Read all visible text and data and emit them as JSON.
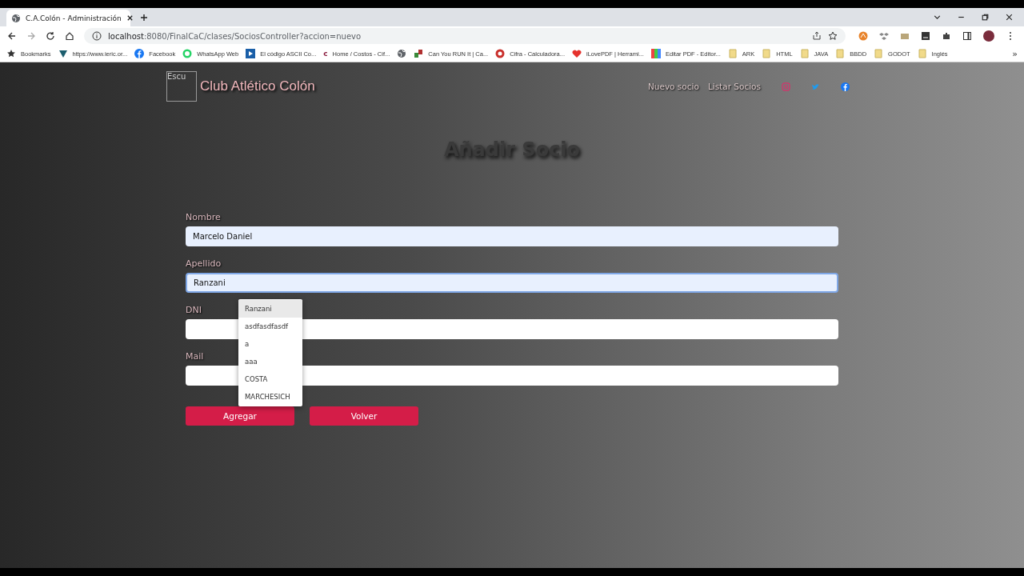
{
  "browser": {
    "tab_title": "C.A.Colón - Administración",
    "url_host": "localhost",
    "url_path": ":8080/FinalCaC/clases/SociosController?accion=nuevo",
    "bookmarks": [
      {
        "label": "Bookmarks",
        "kind": "star"
      },
      {
        "label": "https://www.ieric.or...",
        "kind": "triangle"
      },
      {
        "label": "Facebook",
        "kind": "facebook"
      },
      {
        "label": "WhatsApp Web",
        "kind": "whatsapp"
      },
      {
        "label": "El código ASCII Co...",
        "kind": "play"
      },
      {
        "label": "Home / Costos - Cif...",
        "kind": "letter"
      },
      {
        "kind": "globe"
      },
      {
        "label": "Can You RUN It | Ca...",
        "kind": "game"
      },
      {
        "label": "Cifra - Calculadora...",
        "kind": "cifra"
      },
      {
        "label": "iLovePDF | Herrami...",
        "kind": "heart"
      },
      {
        "label": "Editar PDF - Editor...",
        "kind": "grid"
      },
      {
        "label": "ARK",
        "kind": "folder"
      },
      {
        "label": "HTML",
        "kind": "folder"
      },
      {
        "label": "JAVA",
        "kind": "folder"
      },
      {
        "label": "BBDD",
        "kind": "folder"
      },
      {
        "label": "GODOT",
        "kind": "folder"
      },
      {
        "label": "Inglés",
        "kind": "folder"
      }
    ],
    "bookmark_letter": "c",
    "more": "»"
  },
  "site": {
    "logo_alt": "Escu",
    "title": "Club Atlético Colón",
    "nav": [
      "Nuevo socio",
      "Listar Socios"
    ]
  },
  "heading": "Añadir Socio",
  "fields": [
    {
      "label": "Nombre",
      "value": "Marcelo Daniel",
      "autofilled": true,
      "focused": false
    },
    {
      "label": "Apellido",
      "value": "Ranzani",
      "autofilled": true,
      "focused": true
    },
    {
      "label": "DNI",
      "autofilled": false,
      "focused": false
    },
    {
      "label": "Mail",
      "autofilled": false,
      "focused": false
    }
  ],
  "autocomplete": [
    {
      "text": "Ranzani",
      "selected": true
    },
    {
      "text": "asdfasdfasdf",
      "selected": false
    },
    {
      "text": "a",
      "selected": false
    },
    {
      "text": "aaa",
      "selected": false
    },
    {
      "text": "COSTA",
      "selected": false
    },
    {
      "text": "MARCHESICH",
      "selected": false
    }
  ],
  "buttons": [
    "Agregar",
    "Volver"
  ]
}
